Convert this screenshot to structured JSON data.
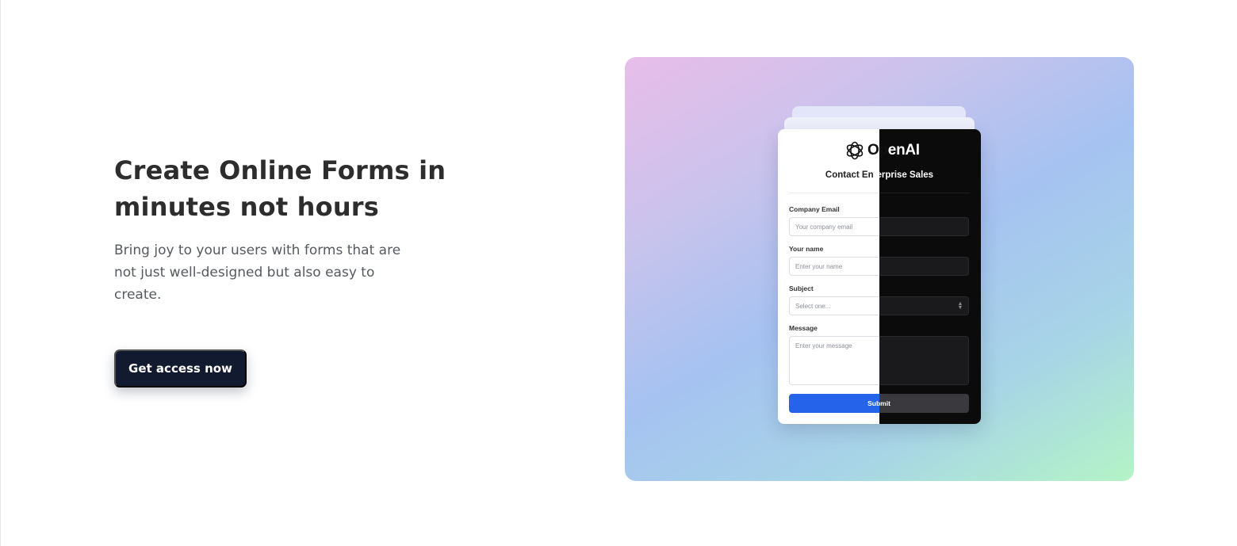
{
  "hero": {
    "title": "Create Online Forms in minutes not hours",
    "subtitle": "Bring joy to your users with forms that are not just well-designed but also easy to create.",
    "cta_label": "Get access now"
  },
  "preview": {
    "brand_left": "Op",
    "brand_right": "enAI",
    "title_left": "Contact En",
    "title_right": "terprise Sales",
    "fields": {
      "company_email": {
        "label": "Company Email",
        "placeholder": "Your company email"
      },
      "your_name": {
        "label": "Your name",
        "placeholder": "Enter your name"
      },
      "subject": {
        "label": "Subject",
        "placeholder": "Select one..."
      },
      "message": {
        "label": "Message",
        "placeholder": "Enter your message"
      }
    },
    "submit_label": "Submit",
    "icons": {
      "logo": "openai-logo-icon",
      "select": "chevron-up-down-icon"
    }
  },
  "colors": {
    "cta_bg": "#111a2e",
    "submit_blue": "#2563eb",
    "dark_panel": "#0b0b0c",
    "gradient_start": "#e8bde9",
    "gradient_mid": "#a6c2f1",
    "gradient_end": "#b4f4c7"
  }
}
